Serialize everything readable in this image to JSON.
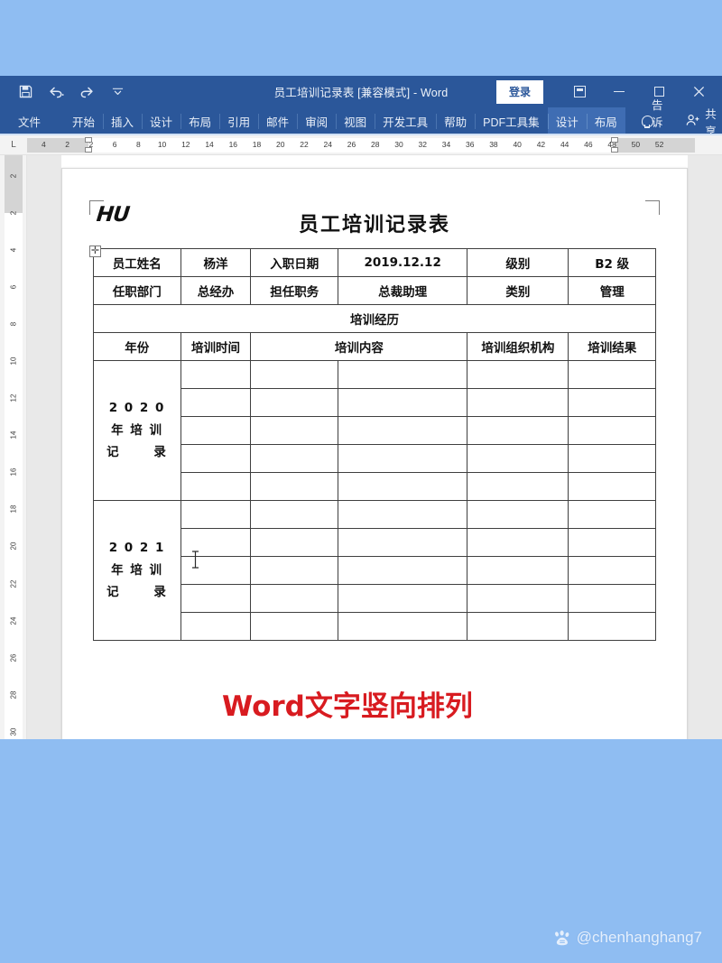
{
  "app": {
    "title_bar": {
      "document_title": "员工培训记录表 [兼容模式]  -  Word",
      "quick_access": [
        {
          "name": "save",
          "icon": "save-icon"
        },
        {
          "name": "undo",
          "icon": "undo-icon"
        },
        {
          "name": "redo",
          "icon": "redo-icon"
        },
        {
          "name": "customize-qat",
          "icon": "chevron-down-icon"
        }
      ],
      "signin_label": "登录",
      "window_controls": [
        {
          "name": "ribbon-display-options",
          "icon": "ribbon-options-icon"
        },
        {
          "name": "minimize",
          "icon": "minimize-icon"
        },
        {
          "name": "maximize",
          "icon": "maximize-icon"
        },
        {
          "name": "close",
          "icon": "close-icon"
        }
      ]
    },
    "ribbon": {
      "tabs": [
        {
          "label": "文件",
          "active": false,
          "contextual": false
        },
        {
          "label": "开始",
          "active": false,
          "contextual": false
        },
        {
          "label": "插入",
          "active": false,
          "contextual": false
        },
        {
          "label": "设计",
          "active": false,
          "contextual": false
        },
        {
          "label": "布局",
          "active": false,
          "contextual": false
        },
        {
          "label": "引用",
          "active": false,
          "contextual": false
        },
        {
          "label": "邮件",
          "active": false,
          "contextual": false
        },
        {
          "label": "审阅",
          "active": false,
          "contextual": false
        },
        {
          "label": "视图",
          "active": false,
          "contextual": false
        },
        {
          "label": "开发工具",
          "active": false,
          "contextual": false
        },
        {
          "label": "帮助",
          "active": false,
          "contextual": false
        },
        {
          "label": "PDF工具集",
          "active": false,
          "contextual": false
        },
        {
          "label": "设计",
          "active": true,
          "contextual": true
        },
        {
          "label": "布局",
          "active": true,
          "contextual": true
        }
      ],
      "tell_me_label": "告诉我",
      "share_label": "共享"
    },
    "rulers": {
      "horizontal_ticks": [
        "4",
        "2",
        "2",
        "6",
        "8",
        "10",
        "12",
        "14",
        "16",
        "18",
        "20",
        "22",
        "24",
        "26",
        "28",
        "30",
        "32",
        "34",
        "36",
        "38",
        "40",
        "42",
        "44",
        "46",
        "48",
        "50",
        "52"
      ],
      "vertical_ticks": [
        "2",
        "2",
        "4",
        "6",
        "8",
        "10",
        "12",
        "14",
        "16",
        "18",
        "20",
        "22",
        "24",
        "26",
        "28",
        "30"
      ],
      "corner_label": "L"
    }
  },
  "document": {
    "logo_text": "HU",
    "title": "员工培训记录表",
    "info_rows": [
      [
        {
          "text": "员工姓名",
          "type": "label"
        },
        {
          "text": "杨洋",
          "type": "value"
        },
        {
          "text": "入职日期",
          "type": "label"
        },
        {
          "text": "2019.12.12",
          "type": "value"
        },
        {
          "text": "级别",
          "type": "label"
        },
        {
          "text": "B2 级",
          "type": "value"
        }
      ],
      [
        {
          "text": "任职部门",
          "type": "label"
        },
        {
          "text": "总经办",
          "type": "value"
        },
        {
          "text": "担任职务",
          "type": "label"
        },
        {
          "text": "总裁助理",
          "type": "value"
        },
        {
          "text": "类别",
          "type": "label"
        },
        {
          "text": "管理",
          "type": "value"
        }
      ]
    ],
    "experience_header": "培训经历",
    "column_headers": [
      "年份",
      "培训时间",
      "培训内容",
      "培训组织机构",
      "培训结果"
    ],
    "year_blocks": [
      {
        "lines": [
          "2 0 2 0",
          "年 培 训",
          "记      录"
        ],
        "empty_rows": 5
      },
      {
        "lines": [
          "2 0 2 1",
          "年 培 训",
          "记      录"
        ],
        "empty_rows": 5
      }
    ]
  },
  "overlays": {
    "annotation_text": "Word文字竖向排列",
    "annotation_color": "#d81b20",
    "watermark_handle": "@chenhanghang7",
    "watermark_logo": "baidu-logo-icon"
  },
  "colors": {
    "page_background": "#8fbdf2",
    "titlebar": "#2b579a",
    "contextual_tab": "#3f6db3",
    "document_paper": "#ffffff",
    "table_border": "#3f3f3f",
    "annotation_red": "#d81b20"
  }
}
